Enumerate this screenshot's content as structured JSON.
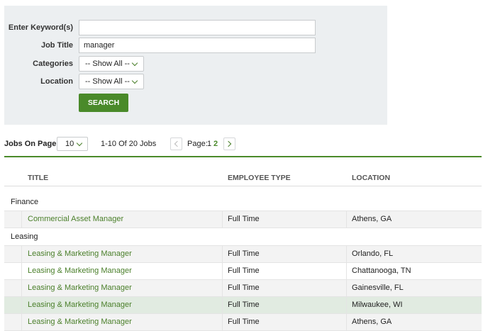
{
  "search": {
    "keyword_label": "Enter Keyword(s)",
    "keyword_value": "",
    "title_label": "Job Title",
    "title_value": "manager",
    "categories_label": "Categories",
    "categories_value": "-- Show All --",
    "location_label": "Location",
    "location_value": "-- Show All --",
    "button_label": "SEARCH"
  },
  "pager": {
    "per_page_label": "Jobs On Page:",
    "per_page_value": "10",
    "count_text": "1-10 Of 20 Jobs",
    "page_label": "Page:",
    "pages": [
      "1",
      "2"
    ],
    "current_page": "2"
  },
  "table": {
    "headers": [
      "TITLE",
      "EMPLOYEE TYPE",
      "LOCATION"
    ],
    "groups": [
      {
        "name": "Finance",
        "rows": [
          {
            "title": "Commercial Asset Manager",
            "type": "Full Time",
            "location": "Athens, GA"
          }
        ]
      },
      {
        "name": "Leasing",
        "rows": [
          {
            "title": "Leasing & Marketing Manager",
            "type": "Full Time",
            "location": "Orlando, FL"
          },
          {
            "title": "Leasing & Marketing Manager",
            "type": "Full Time",
            "location": "Chattanooga, TN"
          },
          {
            "title": "Leasing & Marketing Manager",
            "type": "Full Time",
            "location": "Gainesville, FL"
          },
          {
            "title": "Leasing & Marketing Manager",
            "type": "Full Time",
            "location": "Milwaukee, WI"
          },
          {
            "title": "Leasing & Marketing Manager",
            "type": "Full Time",
            "location": "Athens, GA"
          }
        ]
      }
    ]
  },
  "colors": {
    "accent": "#4a8a2a",
    "link": "#4a7f2a",
    "panel_bg": "#eceff1",
    "row_highlight": "#e1ebe1"
  }
}
